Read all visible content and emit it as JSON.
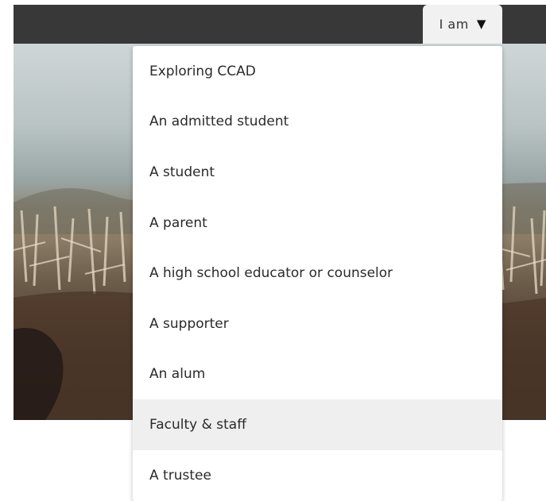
{
  "header": {
    "iam_label": "I am",
    "caret_icon": "caret-down-icon"
  },
  "menu": {
    "items": [
      {
        "label": "Exploring CCAD"
      },
      {
        "label": "An admitted student"
      },
      {
        "label": "A student"
      },
      {
        "label": "A parent"
      },
      {
        "label": "A high school educator or counselor"
      },
      {
        "label": "A supporter"
      },
      {
        "label": "An alum"
      },
      {
        "label": "Faculty & staff",
        "highlighted": true
      },
      {
        "label": "A trustee"
      }
    ]
  },
  "colors": {
    "topbar": "#383838",
    "button_bg": "#f1f1f1",
    "menu_bg": "#ffffff",
    "highlight_bg": "#efefef"
  }
}
